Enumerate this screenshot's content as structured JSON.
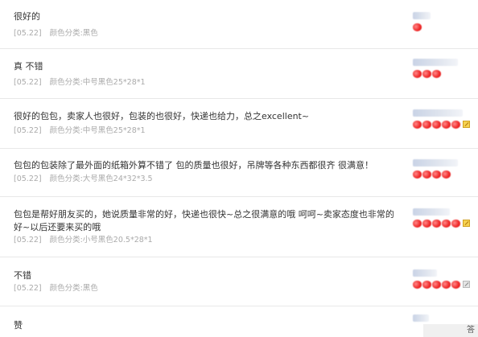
{
  "reviews": [
    {
      "content": "很好的",
      "date": "[05.22]",
      "sku": "颜色分类:黑色",
      "hearts": 1,
      "pic_icon": ""
    },
    {
      "content": "真 不错",
      "date": "[05.22]",
      "sku": "颜色分类:中号黑色25*28*1",
      "hearts": 3,
      "pic_icon": ""
    },
    {
      "content": "很好的包包，卖家人也很好，包装的也很好，快递也给力，总之excellent~",
      "date": "[05.22]",
      "sku": "颜色分类:中号黑色25*28*1",
      "hearts": 5,
      "pic_icon": "pic-icon"
    },
    {
      "content": "包包的包装除了最外面的纸箱外算不错了 包的质量也很好，吊牌等各种东西都很齐 很满意！",
      "date": "[05.22]",
      "sku": "颜色分类:大号黑色24*32*3.5",
      "hearts": 4,
      "pic_icon": ""
    },
    {
      "content": "包包是帮好朋友买的，她说质量非常的好，快递也很快~总之很满意的哦 呵呵~卖家态度也非常的好~以后还要来买的哦",
      "date": "[05.22]",
      "sku": "颜色分类:小号黑色20.5*28*1",
      "hearts": 5,
      "pic_icon": "pic-icon"
    },
    {
      "content": "不错",
      "date": "[05.22]",
      "sku": "颜色分类:黑色",
      "hearts": 5,
      "pic_icon": "pic-icon-gray"
    },
    {
      "content": "赞",
      "date": "",
      "sku": "",
      "hearts": 0,
      "pic_icon": ""
    }
  ],
  "watermark": "答"
}
